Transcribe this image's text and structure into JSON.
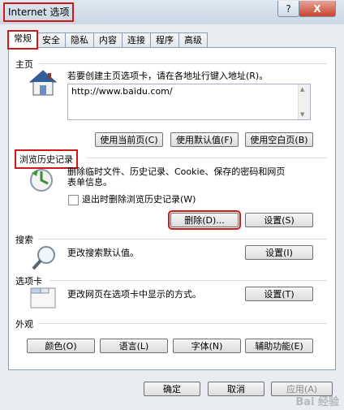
{
  "window": {
    "title": "Internet 选项",
    "help_label": "?",
    "close_label": "X"
  },
  "tabs": [
    {
      "label": "常规"
    },
    {
      "label": "安全"
    },
    {
      "label": "隐私"
    },
    {
      "label": "内容"
    },
    {
      "label": "连接"
    },
    {
      "label": "程序"
    },
    {
      "label": "高级"
    }
  ],
  "homepage": {
    "title": "主页",
    "description": "若要创建主页选项卡，请在各地址行键入地址(R)。",
    "url": "http://www.baidu.com/",
    "use_current": "使用当前页(C)",
    "use_default": "使用默认值(F)",
    "use_blank": "使用空白页(B)"
  },
  "history": {
    "title": "浏览历史记录",
    "description_line1": "删除临时文件、历史记录、Cookie、保存的密码和网页",
    "description_line2": "表单信息。",
    "checkbox_label": "退出时删除浏览历史记录(W)",
    "delete_button": "删除(D)...",
    "settings_button": "设置(S)"
  },
  "search": {
    "title": "搜索",
    "description": "更改搜索默认值。",
    "settings_button": "设置(I)"
  },
  "tabs_section": {
    "title": "选项卡",
    "description": "更改网页在选项卡中显示的方式。",
    "settings_button": "设置(T)"
  },
  "appearance": {
    "title": "外观",
    "colors": "颜色(O)",
    "languages": "语言(L)",
    "fonts": "字体(N)",
    "accessibility": "辅助功能(E)"
  },
  "footer": {
    "ok": "确定",
    "cancel": "取消",
    "apply": "应用(A)"
  },
  "watermark": "Bai 经验",
  "colors": {
    "highlight": "#d01818",
    "panel_border": "#8f9db2",
    "house_roof": "#2f5f9a"
  }
}
